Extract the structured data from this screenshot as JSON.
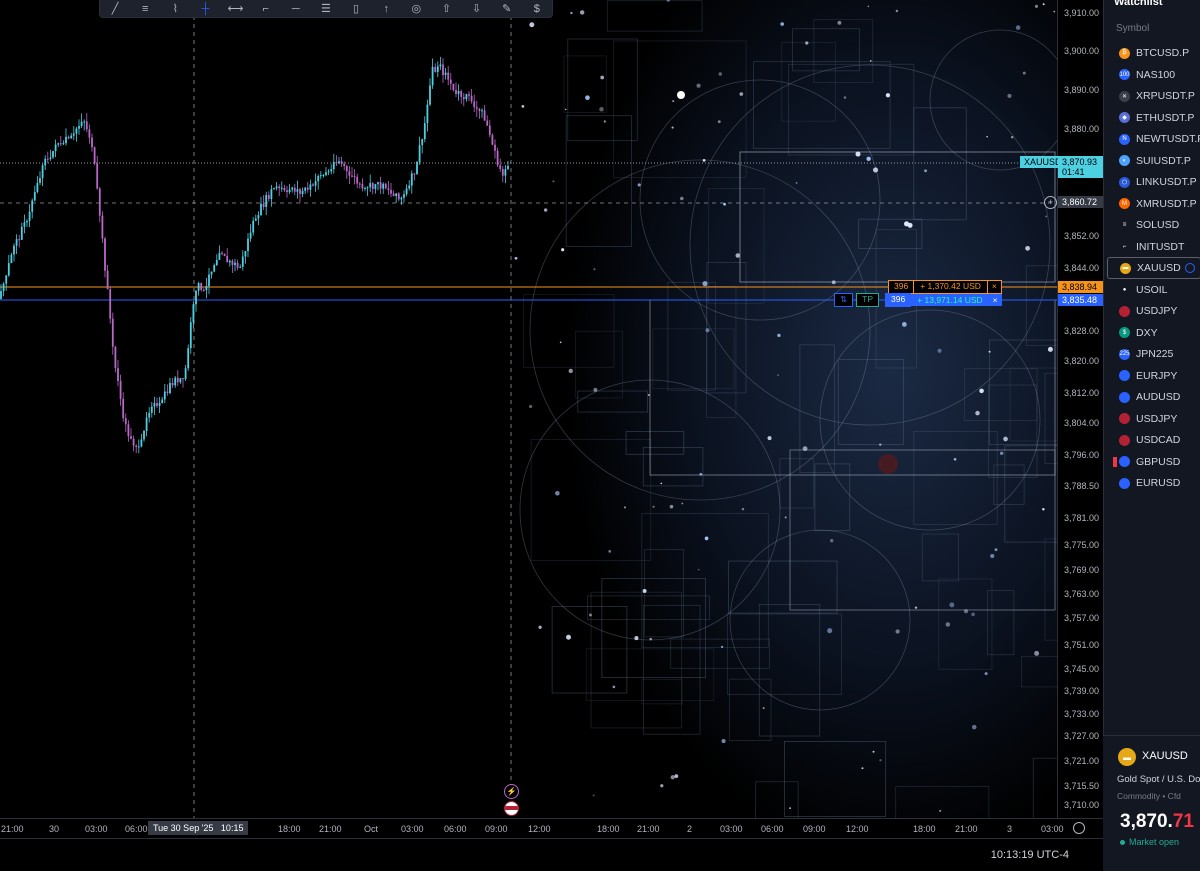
{
  "toolbar": {
    "tools": [
      "trend-line-icon",
      "fib-icon",
      "path-icon",
      "crosshair-icon",
      "measure-icon",
      "brush-icon",
      "horizontal-line-icon",
      "text-lines-icon",
      "flag-icon",
      "arrow-up-icon",
      "circle-icon",
      "arrow-up-bold-icon",
      "arrow-down-bold-icon",
      "pen-icon",
      "price-tag-icon"
    ],
    "glyphs": [
      "╱",
      "≡",
      "⌇",
      "┼",
      "⟷",
      "⌐",
      "─",
      "☰",
      "▯",
      "↑",
      "◎",
      "⇧",
      "⇩",
      "✎",
      "$"
    ]
  },
  "chart": {
    "last_symbol_tag": "XAUUSD",
    "last_price": "3,870.93",
    "countdown": "01:41",
    "crosshair_price": "3,860.72",
    "position_1": {
      "qty": "396",
      "pnl": "+ 1,370.42 USD",
      "close": "×",
      "price": "3,838.94",
      "color": "#f7931a"
    },
    "position_2": {
      "qty": "396",
      "pnl": "+ 13,971.14 USD",
      "close": "×",
      "tp_label": "TP",
      "sl_label": "⇅",
      "price": "3,835.48",
      "color": "#2962ff"
    },
    "bar_up_color": "#4dd0e1",
    "bar_down_color": "#ba68c8"
  },
  "price_axis": {
    "labels": [
      "3,910.00",
      "3,900.00",
      "3,890.00",
      "3,880.00",
      "3,852.00",
      "3,844.00",
      "3,828.00",
      "3,820.00",
      "3,812.00",
      "3,804.00",
      "3,796.00",
      "3,788.50",
      "3,781.00",
      "3,775.00",
      "3,769.00",
      "3,763.00",
      "3,757.00",
      "3,751.00",
      "3,745.00",
      "3,739.00",
      "3,733.00",
      "3,727.00",
      "3,721.00",
      "3,715.50",
      "3,710.00"
    ]
  },
  "time_axis": {
    "labels": [
      "21:00",
      "30",
      "03:00",
      "06:00",
      "18:00",
      "21:00",
      "Oct",
      "03:00",
      "06:00",
      "09:00",
      "12:00",
      "18:00",
      "21:00",
      "2",
      "03:00",
      "06:00",
      "09:00",
      "12:00",
      "18:00",
      "21:00",
      "3",
      "03:00"
    ],
    "crosshair_label": "Tue 30 Sep '25   10:15"
  },
  "status_bar": {
    "clock": "10:13:19 UTC-4"
  },
  "watchlist": {
    "title": "Watchlist",
    "column_header": "Symbol",
    "items": [
      {
        "symbol": "BTCUSD.P",
        "icon": "bitcoin-icon",
        "color": "#f7931a",
        "glyph": "₿"
      },
      {
        "symbol": "NAS100",
        "icon": "nasdaq-icon",
        "color": "#2962ff",
        "glyph": "100"
      },
      {
        "symbol": "XRPUSDT.P",
        "icon": "xrp-icon",
        "color": "#3a3e4a",
        "glyph": "✕"
      },
      {
        "symbol": "ETHUSDT.P",
        "icon": "ethereum-icon",
        "color": "#5a6fd6",
        "glyph": "◆"
      },
      {
        "symbol": "NEWTUSDT.P",
        "icon": "newt-icon",
        "color": "#2962ff",
        "glyph": "N"
      },
      {
        "symbol": "SUIUSDT.P",
        "icon": "sui-icon",
        "color": "#4da2ff",
        "glyph": "◐"
      },
      {
        "symbol": "LINKUSDT.P",
        "icon": "chainlink-icon",
        "color": "#2a5ada",
        "glyph": "⬡"
      },
      {
        "symbol": "XMRUSDT.P",
        "icon": "monero-icon",
        "color": "#ff6600",
        "glyph": "M"
      },
      {
        "symbol": "SOLUSD",
        "icon": "solana-icon",
        "color": "#131722",
        "glyph": "≡"
      },
      {
        "symbol": "INITUSDT",
        "icon": "init-icon",
        "color": "#131722",
        "glyph": "⌐"
      },
      {
        "symbol": "XAUUSD",
        "icon": "gold-icon",
        "color": "#e6a817",
        "glyph": "▬"
      },
      {
        "symbol": "USOIL",
        "icon": "oil-drop-icon",
        "color": "#131722",
        "glyph": "●"
      },
      {
        "symbol": "USDJPY",
        "icon": "flag-us-jp-icon",
        "color": "#b22234",
        "glyph": ""
      },
      {
        "symbol": "DXY",
        "icon": "dollar-icon",
        "color": "#089981",
        "glyph": "$"
      },
      {
        "symbol": "JPN225",
        "icon": "jpn225-icon",
        "color": "#2962ff",
        "glyph": "225"
      },
      {
        "symbol": "EURJPY",
        "icon": "flag-eu-jp-icon",
        "color": "#2962ff",
        "glyph": ""
      },
      {
        "symbol": "AUDUSD",
        "icon": "flag-au-us-icon",
        "color": "#2962ff",
        "glyph": ""
      },
      {
        "symbol": "USDJPY",
        "icon": "flag-us-jp-icon",
        "color": "#b22234",
        "glyph": ""
      },
      {
        "symbol": "USDCAD",
        "icon": "flag-us-ca-icon",
        "color": "#b22234",
        "glyph": ""
      },
      {
        "symbol": "GBPUSD",
        "icon": "flag-gb-us-icon",
        "color": "#2962ff",
        "glyph": ""
      },
      {
        "symbol": "EURUSD",
        "icon": "flag-eu-us-icon",
        "color": "#2962ff",
        "glyph": ""
      }
    ],
    "active_index": 10,
    "flagged_index": 19
  },
  "details": {
    "symbol": "XAUUSD",
    "description": "Gold Spot / U.S. Dollar",
    "category": "Commodity • Cfd",
    "price_main": "3,870.",
    "price_tail": "71",
    "status": "Market open"
  }
}
